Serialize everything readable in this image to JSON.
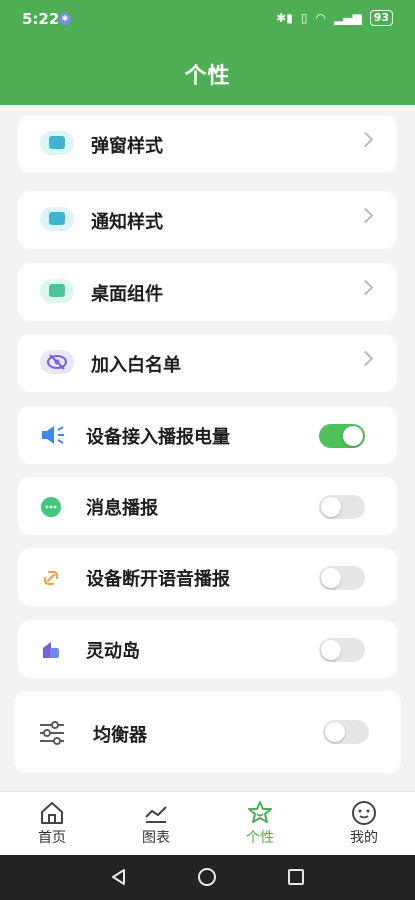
{
  "status": {
    "time": "5:22",
    "battery": "93"
  },
  "header": {
    "title": "个性"
  },
  "items": [
    {
      "label": "弹窗样式"
    },
    {
      "label": "通知样式"
    },
    {
      "label": "桌面组件"
    },
    {
      "label": "加入白名单"
    },
    {
      "label": "设备接入播报电量",
      "toggle": true
    },
    {
      "label": "消息播报",
      "toggle": false
    },
    {
      "label": "设备断开语音播报",
      "toggle": false
    },
    {
      "label": "灵动岛",
      "toggle": false
    },
    {
      "label": "均衡器",
      "toggle": false
    }
  ],
  "nav": [
    {
      "label": "首页"
    },
    {
      "label": "图表"
    },
    {
      "label": "个性",
      "active": true
    },
    {
      "label": "我的"
    }
  ],
  "colors": {
    "accent": "#4eae53",
    "toggle_on": "#4ec15a"
  }
}
